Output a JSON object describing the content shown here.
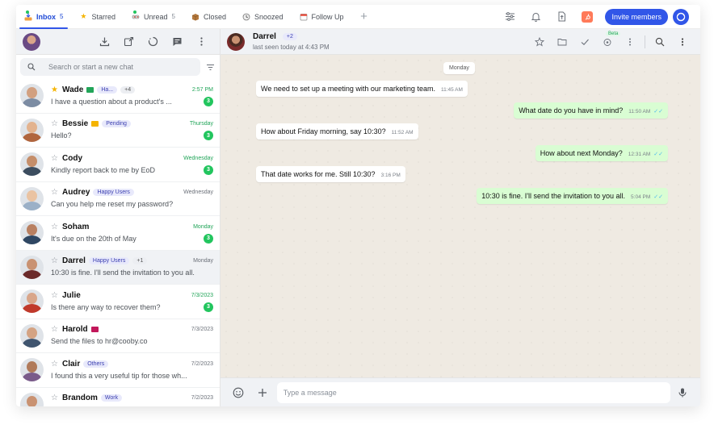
{
  "tabs": [
    {
      "label": "Inbox",
      "count": "5",
      "active": true
    },
    {
      "label": "Starred",
      "count": ""
    },
    {
      "label": "Unread",
      "count": "5"
    },
    {
      "label": "Closed",
      "count": ""
    },
    {
      "label": "Snoozed",
      "count": ""
    },
    {
      "label": "Follow Up",
      "count": ""
    }
  ],
  "header": {
    "invite_label": "Invite members"
  },
  "search": {
    "placeholder": "Search or start a new chat"
  },
  "chats": [
    {
      "name": "Wade",
      "starred": true,
      "flag": "#22a559",
      "tags": [
        "Ha...",
        "+4"
      ],
      "time": "2:57 PM",
      "unread_time": true,
      "preview": "I have a question about a product's ...",
      "badge": "3",
      "skin": "#d2a080",
      "shirt": "#7c8ca3"
    },
    {
      "name": "Bessie",
      "starred": false,
      "flag": "#f5b400",
      "tags": [
        "Pending"
      ],
      "time": "Thursday",
      "unread_time": true,
      "preview": "Hello?",
      "badge": "3",
      "skin": "#e3b38f",
      "shirt": "#b0653e"
    },
    {
      "name": "Cody",
      "starred": false,
      "flag": "",
      "tags": [],
      "time": "Wednesday",
      "unread_time": true,
      "preview": "Kindly report back to me by EoD",
      "badge": "3",
      "skin": "#c58e6a",
      "shirt": "#3c4d5f"
    },
    {
      "name": "Audrey",
      "starred": false,
      "flag": "",
      "tags": [
        "Happy Users"
      ],
      "time": "Wednesday",
      "unread_time": false,
      "preview": "Can you help me reset my password?",
      "badge": "",
      "skin": "#eac3a2",
      "shirt": "#9bb0c7"
    },
    {
      "name": "Soham",
      "starred": false,
      "flag": "",
      "tags": [],
      "time": "Monday",
      "unread_time": true,
      "preview": "It's due on the 20th of May",
      "badge": "3",
      "skin": "#b98061",
      "shirt": "#2f4763"
    },
    {
      "name": "Darrel",
      "starred": false,
      "flag": "",
      "tags": [
        "Happy Users",
        "+1"
      ],
      "time": "Monday",
      "unread_time": false,
      "preview": "10:30 is fine. I'll send the invitation to you all.",
      "badge": "",
      "skin": "#c99272",
      "shirt": "#6b2a2a",
      "selected": true
    },
    {
      "name": "Julie",
      "starred": false,
      "flag": "",
      "tags": [],
      "time": "7/3/2023",
      "unread_time": true,
      "preview": "Is there any way to recover them?",
      "badge": "3",
      "skin": "#d9a68a",
      "shirt": "#c0392b"
    },
    {
      "name": "Harold",
      "starred": false,
      "flag": "#c2185b",
      "tags": [],
      "time": "7/3/2023",
      "unread_time": false,
      "preview": "Send the files to hr@cooby.co",
      "badge": "",
      "skin": "#d4a383",
      "shirt": "#40556f"
    },
    {
      "name": "Clair",
      "starred": false,
      "flag": "",
      "tags": [
        "Others"
      ],
      "time": "7/2/2023",
      "unread_time": false,
      "preview": "I found this a very useful tip for those wh...",
      "badge": "",
      "skin": "#b07a5a",
      "shirt": "#7a5b8a"
    },
    {
      "name": "Brandom",
      "starred": false,
      "flag": "",
      "tags": [
        "Work"
      ],
      "time": "7/2/2023",
      "unread_time": false,
      "preview": "",
      "badge": "",
      "skin": "#c99272",
      "shirt": "#333"
    }
  ],
  "conversation": {
    "name": "Darrel",
    "plus": "+2",
    "status": "last seen today at 4:43 PM",
    "beta_label": "Beta",
    "day_label": "Monday",
    "messages": [
      {
        "dir": "in",
        "text": "We need to set up a meeting with our marketing team.",
        "time": "11:45 AM"
      },
      {
        "dir": "out",
        "text": "What date do you have in mind?",
        "time": "11:50 AM"
      },
      {
        "dir": "in",
        "text": "How about Friday morning, say 10:30?",
        "time": "11:52 AM"
      },
      {
        "dir": "out",
        "text": "How about next Monday?",
        "time": "12:31 AM"
      },
      {
        "dir": "in",
        "text": "That date works for me. Still 10:30?",
        "time": "3:16 PM"
      },
      {
        "dir": "out",
        "text": "10:30 is fine. I'll send the invitation to you all.",
        "time": "5:04 PM"
      }
    ],
    "composer_placeholder": "Type a message"
  }
}
